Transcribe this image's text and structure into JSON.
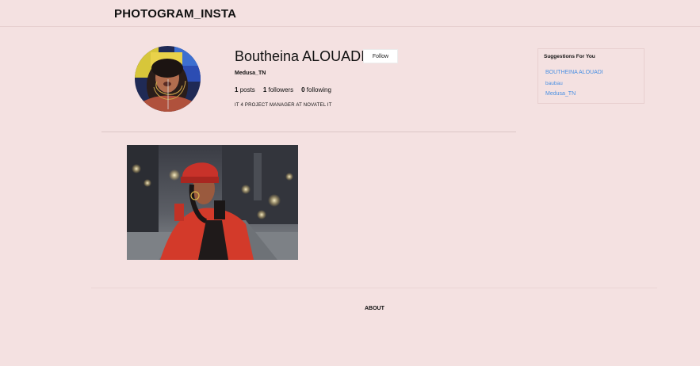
{
  "header": {
    "brand": "PHOTOGRAM_INSTA"
  },
  "profile": {
    "name": "Boutheina ALOUADI",
    "follow_label": "Follow",
    "username": "Medusa_TN",
    "posts_count": "1",
    "posts_label": "posts",
    "followers_count": "1",
    "followers_label": "followers",
    "following_count": "0",
    "following_label": "following",
    "bio": "IT 4 PROJECT MANAGER AT NOVATEL IT"
  },
  "suggestions": {
    "title": "Suggestions For You",
    "items": [
      "BOUTHEINA ALOUADI",
      "baubau",
      "Medusa_TN"
    ]
  },
  "footer": {
    "about_label": "ABOUT"
  },
  "colors": {
    "background": "#f4e1e1",
    "link": "#4a90e2",
    "accent_red": "#d33a2a"
  }
}
